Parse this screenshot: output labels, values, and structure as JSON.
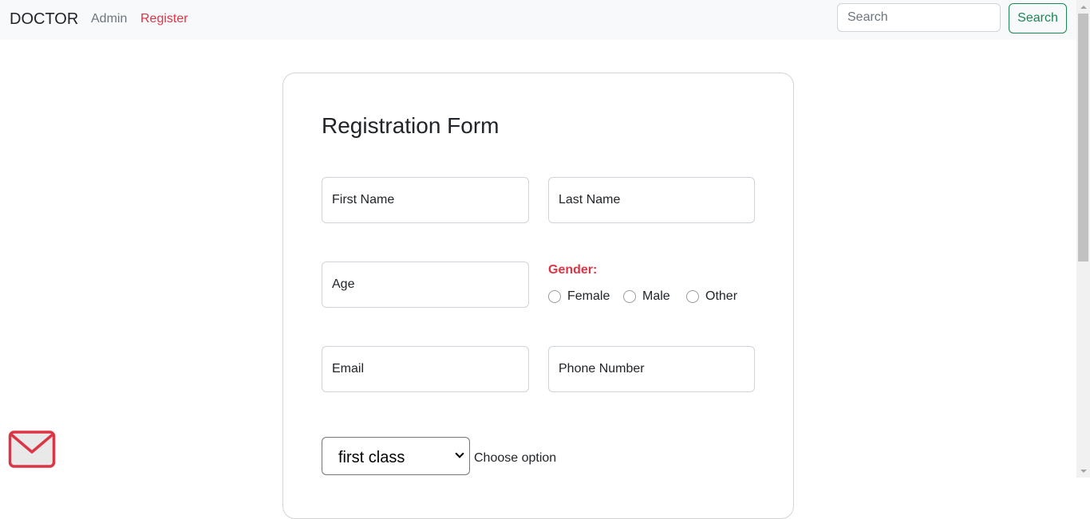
{
  "navbar": {
    "brand": "DOCTOR",
    "links": [
      {
        "label": "Admin",
        "color": "#6c757d"
      },
      {
        "label": "Register",
        "color": "#dc3545"
      }
    ],
    "search": {
      "placeholder": "Search",
      "value": ""
    },
    "search_button": "Search"
  },
  "form": {
    "title": "Registration Form",
    "first_name_placeholder": "First Name",
    "last_name_placeholder": "Last Name",
    "age_placeholder": "Age",
    "email_placeholder": "Email",
    "phone_placeholder": "Phone Number",
    "gender": {
      "label": "Gender:",
      "options": [
        "Female",
        "Male",
        "Other"
      ]
    },
    "class_select": {
      "selected": "first class",
      "label": "Choose option"
    }
  },
  "floating": {
    "icon": "mail-icon"
  },
  "colors": {
    "accent_red": "#dc3545",
    "success_green": "#198754",
    "navbar_bg": "#f8f9fa"
  }
}
